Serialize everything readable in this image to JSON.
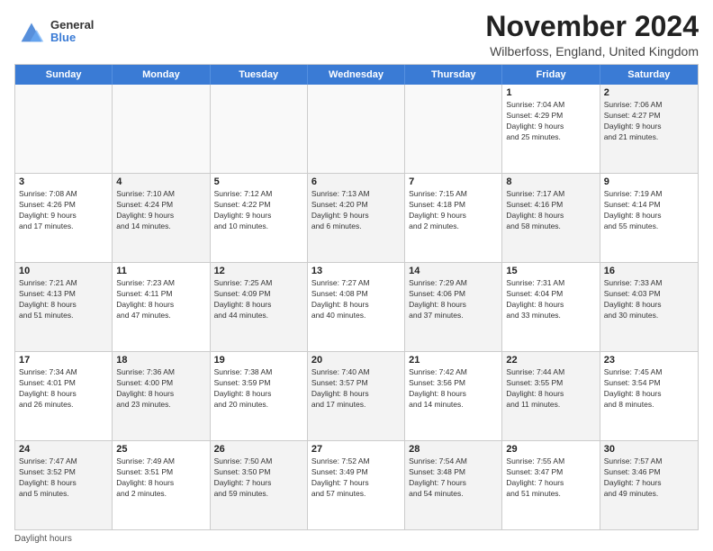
{
  "logo": {
    "general": "General",
    "blue": "Blue"
  },
  "title": "November 2024",
  "subtitle": "Wilberfoss, England, United Kingdom",
  "header_days": [
    "Sunday",
    "Monday",
    "Tuesday",
    "Wednesday",
    "Thursday",
    "Friday",
    "Saturday"
  ],
  "footer": "Daylight hours",
  "rows": [
    [
      {
        "num": "",
        "info": "",
        "empty": true
      },
      {
        "num": "",
        "info": "",
        "empty": true
      },
      {
        "num": "",
        "info": "",
        "empty": true
      },
      {
        "num": "",
        "info": "",
        "empty": true
      },
      {
        "num": "",
        "info": "",
        "empty": true
      },
      {
        "num": "1",
        "info": "Sunrise: 7:04 AM\nSunset: 4:29 PM\nDaylight: 9 hours\nand 25 minutes.",
        "empty": false,
        "alt": false
      },
      {
        "num": "2",
        "info": "Sunrise: 7:06 AM\nSunset: 4:27 PM\nDaylight: 9 hours\nand 21 minutes.",
        "empty": false,
        "alt": true
      }
    ],
    [
      {
        "num": "3",
        "info": "Sunrise: 7:08 AM\nSunset: 4:26 PM\nDaylight: 9 hours\nand 17 minutes.",
        "empty": false,
        "alt": false
      },
      {
        "num": "4",
        "info": "Sunrise: 7:10 AM\nSunset: 4:24 PM\nDaylight: 9 hours\nand 14 minutes.",
        "empty": false,
        "alt": true
      },
      {
        "num": "5",
        "info": "Sunrise: 7:12 AM\nSunset: 4:22 PM\nDaylight: 9 hours\nand 10 minutes.",
        "empty": false,
        "alt": false
      },
      {
        "num": "6",
        "info": "Sunrise: 7:13 AM\nSunset: 4:20 PM\nDaylight: 9 hours\nand 6 minutes.",
        "empty": false,
        "alt": true
      },
      {
        "num": "7",
        "info": "Sunrise: 7:15 AM\nSunset: 4:18 PM\nDaylight: 9 hours\nand 2 minutes.",
        "empty": false,
        "alt": false
      },
      {
        "num": "8",
        "info": "Sunrise: 7:17 AM\nSunset: 4:16 PM\nDaylight: 8 hours\nand 58 minutes.",
        "empty": false,
        "alt": true
      },
      {
        "num": "9",
        "info": "Sunrise: 7:19 AM\nSunset: 4:14 PM\nDaylight: 8 hours\nand 55 minutes.",
        "empty": false,
        "alt": false
      }
    ],
    [
      {
        "num": "10",
        "info": "Sunrise: 7:21 AM\nSunset: 4:13 PM\nDaylight: 8 hours\nand 51 minutes.",
        "empty": false,
        "alt": true
      },
      {
        "num": "11",
        "info": "Sunrise: 7:23 AM\nSunset: 4:11 PM\nDaylight: 8 hours\nand 47 minutes.",
        "empty": false,
        "alt": false
      },
      {
        "num": "12",
        "info": "Sunrise: 7:25 AM\nSunset: 4:09 PM\nDaylight: 8 hours\nand 44 minutes.",
        "empty": false,
        "alt": true
      },
      {
        "num": "13",
        "info": "Sunrise: 7:27 AM\nSunset: 4:08 PM\nDaylight: 8 hours\nand 40 minutes.",
        "empty": false,
        "alt": false
      },
      {
        "num": "14",
        "info": "Sunrise: 7:29 AM\nSunset: 4:06 PM\nDaylight: 8 hours\nand 37 minutes.",
        "empty": false,
        "alt": true
      },
      {
        "num": "15",
        "info": "Sunrise: 7:31 AM\nSunset: 4:04 PM\nDaylight: 8 hours\nand 33 minutes.",
        "empty": false,
        "alt": false
      },
      {
        "num": "16",
        "info": "Sunrise: 7:33 AM\nSunset: 4:03 PM\nDaylight: 8 hours\nand 30 minutes.",
        "empty": false,
        "alt": true
      }
    ],
    [
      {
        "num": "17",
        "info": "Sunrise: 7:34 AM\nSunset: 4:01 PM\nDaylight: 8 hours\nand 26 minutes.",
        "empty": false,
        "alt": false
      },
      {
        "num": "18",
        "info": "Sunrise: 7:36 AM\nSunset: 4:00 PM\nDaylight: 8 hours\nand 23 minutes.",
        "empty": false,
        "alt": true
      },
      {
        "num": "19",
        "info": "Sunrise: 7:38 AM\nSunset: 3:59 PM\nDaylight: 8 hours\nand 20 minutes.",
        "empty": false,
        "alt": false
      },
      {
        "num": "20",
        "info": "Sunrise: 7:40 AM\nSunset: 3:57 PM\nDaylight: 8 hours\nand 17 minutes.",
        "empty": false,
        "alt": true
      },
      {
        "num": "21",
        "info": "Sunrise: 7:42 AM\nSunset: 3:56 PM\nDaylight: 8 hours\nand 14 minutes.",
        "empty": false,
        "alt": false
      },
      {
        "num": "22",
        "info": "Sunrise: 7:44 AM\nSunset: 3:55 PM\nDaylight: 8 hours\nand 11 minutes.",
        "empty": false,
        "alt": true
      },
      {
        "num": "23",
        "info": "Sunrise: 7:45 AM\nSunset: 3:54 PM\nDaylight: 8 hours\nand 8 minutes.",
        "empty": false,
        "alt": false
      }
    ],
    [
      {
        "num": "24",
        "info": "Sunrise: 7:47 AM\nSunset: 3:52 PM\nDaylight: 8 hours\nand 5 minutes.",
        "empty": false,
        "alt": true
      },
      {
        "num": "25",
        "info": "Sunrise: 7:49 AM\nSunset: 3:51 PM\nDaylight: 8 hours\nand 2 minutes.",
        "empty": false,
        "alt": false
      },
      {
        "num": "26",
        "info": "Sunrise: 7:50 AM\nSunset: 3:50 PM\nDaylight: 7 hours\nand 59 minutes.",
        "empty": false,
        "alt": true
      },
      {
        "num": "27",
        "info": "Sunrise: 7:52 AM\nSunset: 3:49 PM\nDaylight: 7 hours\nand 57 minutes.",
        "empty": false,
        "alt": false
      },
      {
        "num": "28",
        "info": "Sunrise: 7:54 AM\nSunset: 3:48 PM\nDaylight: 7 hours\nand 54 minutes.",
        "empty": false,
        "alt": true
      },
      {
        "num": "29",
        "info": "Sunrise: 7:55 AM\nSunset: 3:47 PM\nDaylight: 7 hours\nand 51 minutes.",
        "empty": false,
        "alt": false
      },
      {
        "num": "30",
        "info": "Sunrise: 7:57 AM\nSunset: 3:46 PM\nDaylight: 7 hours\nand 49 minutes.",
        "empty": false,
        "alt": true
      }
    ]
  ]
}
